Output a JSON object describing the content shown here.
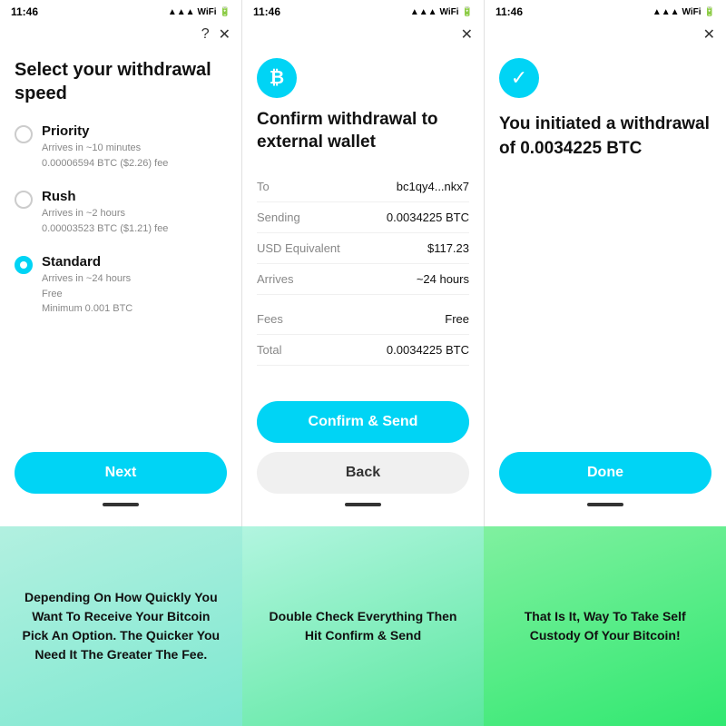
{
  "screens": [
    {
      "time": "11:46",
      "title": "Select your withdrawal speed",
      "options": [
        {
          "label": "Priority",
          "desc": "Arrives in ~10 minutes\n0.00006594 BTC ($2.26) fee",
          "selected": false
        },
        {
          "label": "Rush",
          "desc": "Arrives in ~2 hours\n0.00003523 BTC ($1.21) fee",
          "selected": false
        },
        {
          "label": "Standard",
          "desc": "Arrives in ~24 hours\nFree\nMinimum 0.001 BTC",
          "selected": true
        }
      ],
      "button": "Next",
      "hasHelp": true
    },
    {
      "time": "11:46",
      "title": "Confirm withdrawal to external wallet",
      "coinSymbol": "₿",
      "details": [
        {
          "label": "To",
          "value": "bc1qy4...nkx7"
        },
        {
          "label": "Sending",
          "value": "0.0034225 BTC"
        },
        {
          "label": "USD Equivalent",
          "value": "$117.23"
        },
        {
          "label": "Arrives",
          "value": "~24 hours"
        }
      ],
      "details2": [
        {
          "label": "Fees",
          "value": "Free"
        },
        {
          "label": "Total",
          "value": "0.0034225 BTC"
        }
      ],
      "primaryButton": "Confirm & Send",
      "secondaryButton": "Back"
    },
    {
      "time": "11:46",
      "title": "You initiated a withdrawal of 0.0034225 BTC",
      "button": "Done"
    }
  ],
  "captions": [
    "Depending On How Quickly You Want To Receive Your Bitcoin Pick An Option. The Quicker You Need It The Greater The Fee.",
    "Double Check Everything Then Hit Confirm & Send",
    "That Is It, Way To Take Self Custody Of Your Bitcoin!"
  ]
}
